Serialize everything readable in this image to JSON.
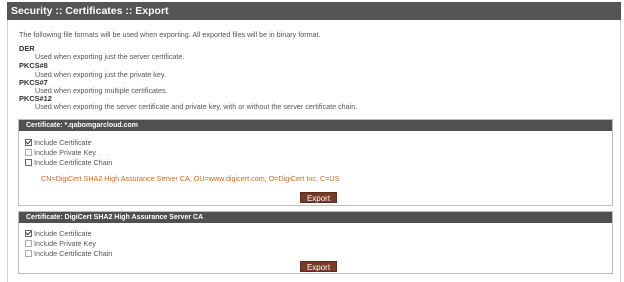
{
  "title": "Security :: Certificates :: Export",
  "intro": "The following file formats will be used when exporting. All exported files will be in binary format.",
  "formats": [
    {
      "name": "DER",
      "desc": "Used when exporting just the server certificate."
    },
    {
      "name": "PKCS#8",
      "desc": "Used when exporting just the private key."
    },
    {
      "name": "PKCS#7",
      "desc": "Used when exporting multiple certificates."
    },
    {
      "name": "PKCS#12",
      "desc": "Used when exporting the server certificate and private key, with or without the server certificate chain."
    }
  ],
  "certificates": [
    {
      "header": "Certificate: *.qabomgarcloud.com",
      "options": [
        {
          "label": "Include Certificate",
          "checked": true,
          "enabled": true
        },
        {
          "label": "Include Private Key",
          "checked": false,
          "enabled": false
        },
        {
          "label": "Include Certificate Chain",
          "checked": false,
          "enabled": true
        }
      ],
      "subject": "CN=DigiCert SHA2 High Assurance Server CA, OU=www.digicert.com, O=DigiCert Inc, C=US",
      "export_label": "Export"
    },
    {
      "header": "Certificate: DigiCert SHA2 High Assurance Server CA",
      "options": [
        {
          "label": "Include Certificate",
          "checked": true,
          "enabled": true
        },
        {
          "label": "Include Private Key",
          "checked": false,
          "enabled": false
        },
        {
          "label": "Include Certificate Chain",
          "checked": false,
          "enabled": false
        }
      ],
      "export_label": "Export"
    }
  ],
  "colors": {
    "title_bg": "#555555",
    "section_header_bg": "#505050",
    "subject_text": "#d2691e",
    "export_button_bg": "#7a3a28"
  }
}
